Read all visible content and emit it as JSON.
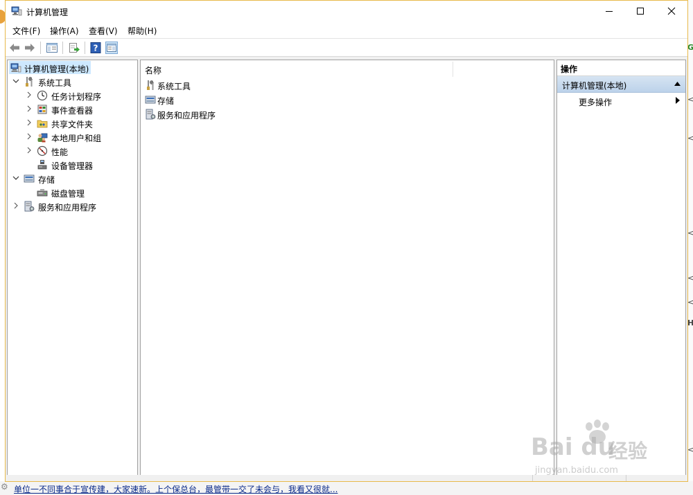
{
  "window": {
    "title": "计算机管理",
    "controls": [
      "minimize",
      "maximize",
      "close"
    ]
  },
  "menu": [
    {
      "label": "文件(F)"
    },
    {
      "label": "操作(A)"
    },
    {
      "label": "查看(V)"
    },
    {
      "label": "帮助(H)"
    }
  ],
  "toolbar": {
    "buttons": [
      "back-arrow-icon",
      "forward-arrow-icon",
      "show-hide-tree-icon",
      "export-list-icon",
      "help-icon",
      "show-hide-action-pane-icon"
    ]
  },
  "tree": {
    "root": "计算机管理(本地)",
    "system_tools": "系统工具",
    "task_scheduler": "任务计划程序",
    "event_viewer": "事件查看器",
    "shared_folders": "共享文件夹",
    "local_users": "本地用户和组",
    "performance": "性能",
    "device_manager": "设备管理器",
    "storage": "存储",
    "disk_management": "磁盘管理",
    "services_apps": "服务和应用程序"
  },
  "list": {
    "column_name": "名称",
    "rows": [
      "系统工具",
      "存储",
      "服务和应用程序"
    ]
  },
  "actions": {
    "header": "操作",
    "section": "计算机管理(本地)",
    "more": "更多操作"
  },
  "background": {
    "bottom_text": "单位一不同事合于宣传建，大家速新。上个保总台，最管带一交了未会与，我看又很就...",
    "right_glyphs": [
      "G",
      "<",
      "<",
      "<",
      "<",
      "<",
      "H",
      "<"
    ]
  },
  "watermark": {
    "brand": "Bai du",
    "brand_cn": "经验",
    "url": "jingyan.baidu.com"
  },
  "colors": {
    "accent_border": "#e8b94a",
    "selection": "#cde8ff",
    "action_section": "#bcd2ea",
    "pane_border": "#a0a0a0"
  }
}
